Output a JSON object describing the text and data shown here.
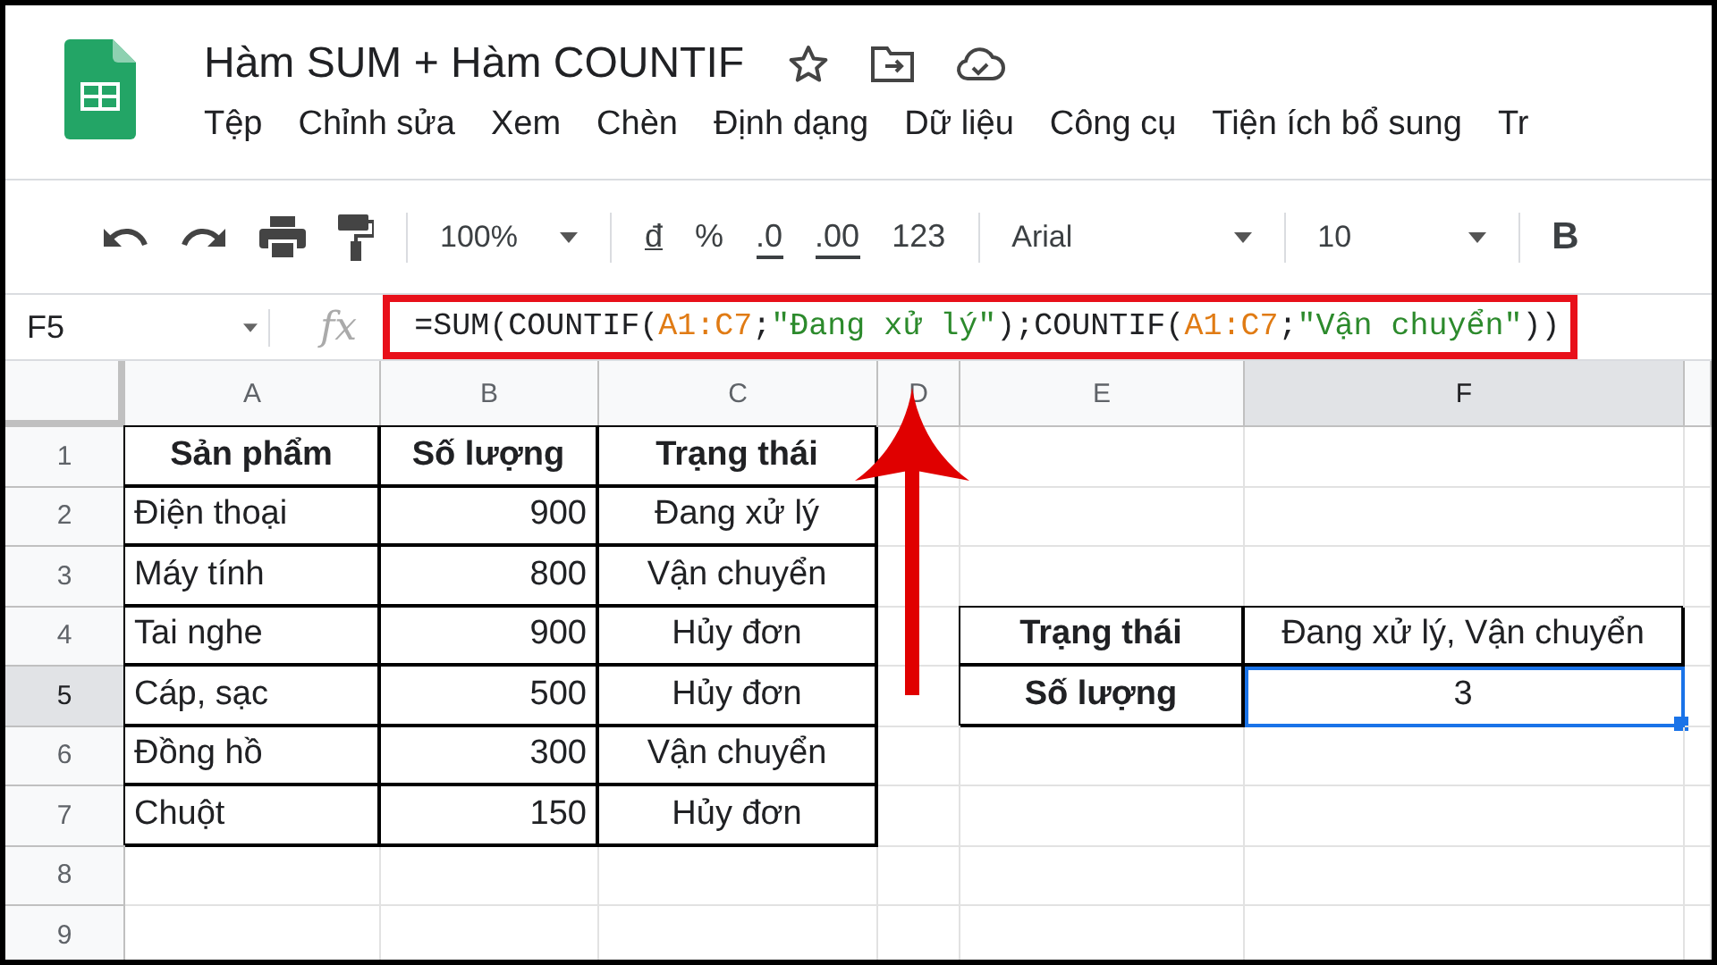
{
  "document": {
    "title": "Hàm SUM + Hàm COUNTIF"
  },
  "menu": [
    "Tệp",
    "Chỉnh sửa",
    "Xem",
    "Chèn",
    "Định dạng",
    "Dữ liệu",
    "Công cụ",
    "Tiện ích bổ sung",
    "Tr"
  ],
  "toolbar": {
    "zoom": "100%",
    "format_buttons": [
      "đ",
      "%",
      ".0",
      ".00",
      "123"
    ],
    "font": "Arial",
    "font_size": "10",
    "bold_button": "B"
  },
  "formula_bar": {
    "name_box": "F5",
    "fx": "fx",
    "parts": [
      {
        "kind": "text",
        "text": "=SUM(COUNTIF("
      },
      {
        "kind": "range",
        "text": "A1:C7"
      },
      {
        "kind": "text",
        "text": ";"
      },
      {
        "kind": "string",
        "text": "\"Đang xử lý\""
      },
      {
        "kind": "text",
        "text": ");COUNTIF("
      },
      {
        "kind": "range",
        "text": "A1:C7"
      },
      {
        "kind": "text",
        "text": ";"
      },
      {
        "kind": "string",
        "text": "\"Vận chuyển\""
      },
      {
        "kind": "text",
        "text": "))"
      }
    ]
  },
  "columns": [
    {
      "label": "A",
      "selected": false
    },
    {
      "label": "B",
      "selected": false
    },
    {
      "label": "C",
      "selected": false
    },
    {
      "label": "D",
      "selected": false
    },
    {
      "label": "E",
      "selected": false
    },
    {
      "label": "F",
      "selected": true
    }
  ],
  "rows": [
    {
      "number": "1",
      "selected": false,
      "cells": [
        {
          "kind": "center",
          "text": "Sản phẩm",
          "bold": true,
          "bordered": true,
          "selected": false
        },
        {
          "kind": "center",
          "text": "Số lượng",
          "bold": true,
          "bordered": true,
          "selected": false
        },
        {
          "kind": "center",
          "text": "Trạng thái",
          "bold": true,
          "bordered": true,
          "selected": false
        },
        {
          "kind": "empty",
          "selected": false
        },
        {
          "kind": "empty",
          "selected": false
        },
        {
          "kind": "empty",
          "selected": false
        }
      ]
    },
    {
      "number": "2",
      "selected": false,
      "cells": [
        {
          "kind": "text",
          "text": "Điện thoại",
          "bold": false,
          "bordered": true,
          "selected": false
        },
        {
          "kind": "number",
          "text": "900",
          "bold": false,
          "bordered": true,
          "selected": false
        },
        {
          "kind": "center",
          "text": "Đang xử lý",
          "bold": false,
          "bordered": true,
          "selected": false
        },
        {
          "kind": "empty",
          "selected": false
        },
        {
          "kind": "empty",
          "selected": false
        },
        {
          "kind": "empty",
          "selected": false
        }
      ]
    },
    {
      "number": "3",
      "selected": false,
      "cells": [
        {
          "kind": "text",
          "text": "Máy tính",
          "bold": false,
          "bordered": true,
          "selected": false
        },
        {
          "kind": "number",
          "text": "800",
          "bold": false,
          "bordered": true,
          "selected": false
        },
        {
          "kind": "center",
          "text": "Vận chuyển",
          "bold": false,
          "bordered": true,
          "selected": false
        },
        {
          "kind": "empty",
          "selected": false
        },
        {
          "kind": "empty",
          "selected": false
        },
        {
          "kind": "empty",
          "selected": false
        }
      ]
    },
    {
      "number": "4",
      "selected": false,
      "cells": [
        {
          "kind": "text",
          "text": "Tai nghe",
          "bold": false,
          "bordered": true,
          "selected": false
        },
        {
          "kind": "number",
          "text": "900",
          "bold": false,
          "bordered": true,
          "selected": false
        },
        {
          "kind": "center",
          "text": "Hủy đơn",
          "bold": false,
          "bordered": true,
          "selected": false
        },
        {
          "kind": "empty",
          "selected": false
        },
        {
          "kind": "center",
          "text": "Trạng thái",
          "bold": true,
          "bordered": true,
          "selected": false
        },
        {
          "kind": "center",
          "text": "Đang xử lý, Vận chuyển",
          "bold": false,
          "bordered": true,
          "selected": false
        }
      ]
    },
    {
      "number": "5",
      "selected": true,
      "cells": [
        {
          "kind": "text",
          "text": "Cáp, sạc",
          "bold": false,
          "bordered": true,
          "selected": false
        },
        {
          "kind": "number",
          "text": "500",
          "bold": false,
          "bordered": true,
          "selected": false
        },
        {
          "kind": "center",
          "text": "Hủy đơn",
          "bold": false,
          "bordered": true,
          "selected": false
        },
        {
          "kind": "empty",
          "selected": false
        },
        {
          "kind": "center",
          "text": "Số lượng",
          "bold": true,
          "bordered": true,
          "selected": false
        },
        {
          "kind": "center",
          "text": "3",
          "bold": false,
          "bordered": true,
          "selected": true
        }
      ]
    },
    {
      "number": "6",
      "selected": false,
      "cells": [
        {
          "kind": "text",
          "text": "Đồng hồ",
          "bold": false,
          "bordered": true,
          "selected": false
        },
        {
          "kind": "number",
          "text": "300",
          "bold": false,
          "bordered": true,
          "selected": false
        },
        {
          "kind": "center",
          "text": "Vận chuyển",
          "bold": false,
          "bordered": true,
          "selected": false
        },
        {
          "kind": "empty",
          "selected": false
        },
        {
          "kind": "empty",
          "selected": false
        },
        {
          "kind": "empty",
          "selected": false
        }
      ]
    },
    {
      "number": "7",
      "selected": false,
      "cells": [
        {
          "kind": "text",
          "text": "Chuột",
          "bold": false,
          "bordered": true,
          "selected": false
        },
        {
          "kind": "number",
          "text": "150",
          "bold": false,
          "bordered": true,
          "selected": false
        },
        {
          "kind": "center",
          "text": "Hủy đơn",
          "bold": false,
          "bordered": true,
          "selected": false
        },
        {
          "kind": "empty",
          "selected": false
        },
        {
          "kind": "empty",
          "selected": false
        },
        {
          "kind": "empty",
          "selected": false
        }
      ]
    },
    {
      "number": "8",
      "selected": false,
      "cells": [
        {
          "kind": "empty",
          "selected": false
        },
        {
          "kind": "empty",
          "selected": false
        },
        {
          "kind": "empty",
          "selected": false
        },
        {
          "kind": "empty",
          "selected": false
        },
        {
          "kind": "empty",
          "selected": false
        },
        {
          "kind": "empty",
          "selected": false
        }
      ]
    },
    {
      "number": "9",
      "selected": false,
      "cells": [
        {
          "kind": "empty",
          "selected": false
        },
        {
          "kind": "empty",
          "selected": false
        },
        {
          "kind": "empty",
          "selected": false
        },
        {
          "kind": "empty",
          "selected": false
        },
        {
          "kind": "empty",
          "selected": false
        },
        {
          "kind": "empty",
          "selected": false
        }
      ]
    }
  ]
}
